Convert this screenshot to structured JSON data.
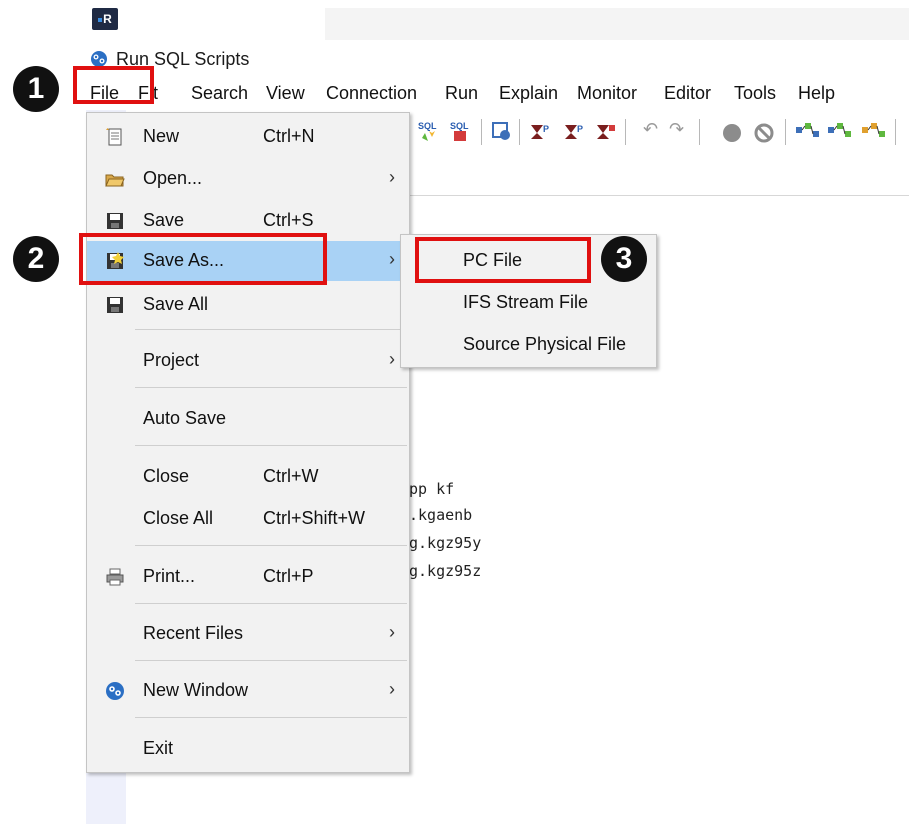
{
  "app": {
    "badge_text": "R",
    "title": "Run SQL Scripts"
  },
  "menubar": {
    "items": [
      "File",
      "Edit",
      "Search",
      "View",
      "Connection",
      "Run",
      "Explain",
      "Monitor",
      "Editor",
      "Tools",
      "Help"
    ],
    "file_label_visible": "File",
    "edit_label_visible": "Fit"
  },
  "file_menu": {
    "items": [
      {
        "label": "New",
        "shortcut": "Ctrl+N",
        "icon": "new-file-icon"
      },
      {
        "label": "Open...",
        "shortcut": "",
        "icon": "open-folder-icon",
        "submenu": true
      },
      {
        "label": "Save",
        "shortcut": "Ctrl+S",
        "icon": "save-icon"
      },
      {
        "label": "Save As...",
        "shortcut": "",
        "icon": "save-as-icon",
        "submenu": true,
        "highlighted": true
      },
      {
        "label": "Save All",
        "shortcut": "",
        "icon": "save-all-icon"
      },
      {
        "label": "Project",
        "shortcut": "",
        "submenu": true
      },
      {
        "label": "Auto Save",
        "shortcut": ""
      },
      {
        "label": "Close",
        "shortcut": "Ctrl+W"
      },
      {
        "label": "Close All",
        "shortcut": "Ctrl+Shift+W"
      },
      {
        "label": "Print...",
        "shortcut": "Ctrl+P",
        "icon": "printer-icon"
      },
      {
        "label": "Recent Files",
        "shortcut": "",
        "submenu": true
      },
      {
        "label": "New Window",
        "shortcut": "",
        "icon": "new-window-icon",
        "submenu": true
      },
      {
        "label": "Exit",
        "shortcut": ""
      }
    ]
  },
  "save_as_submenu": {
    "items": [
      "PC File",
      "IFS Stream File",
      "Source Physical File"
    ]
  },
  "editor": {
    "lines": [
      "pp kf",
      ".kgaenb",
      "g.kgz95y",
      "g.kgz95z"
    ]
  },
  "steps": {
    "one": "1",
    "two": "2",
    "three": "3"
  },
  "colors": {
    "highlight": "#a9d2f5",
    "callout_red": "#e01010",
    "step_badge": "#111111"
  }
}
